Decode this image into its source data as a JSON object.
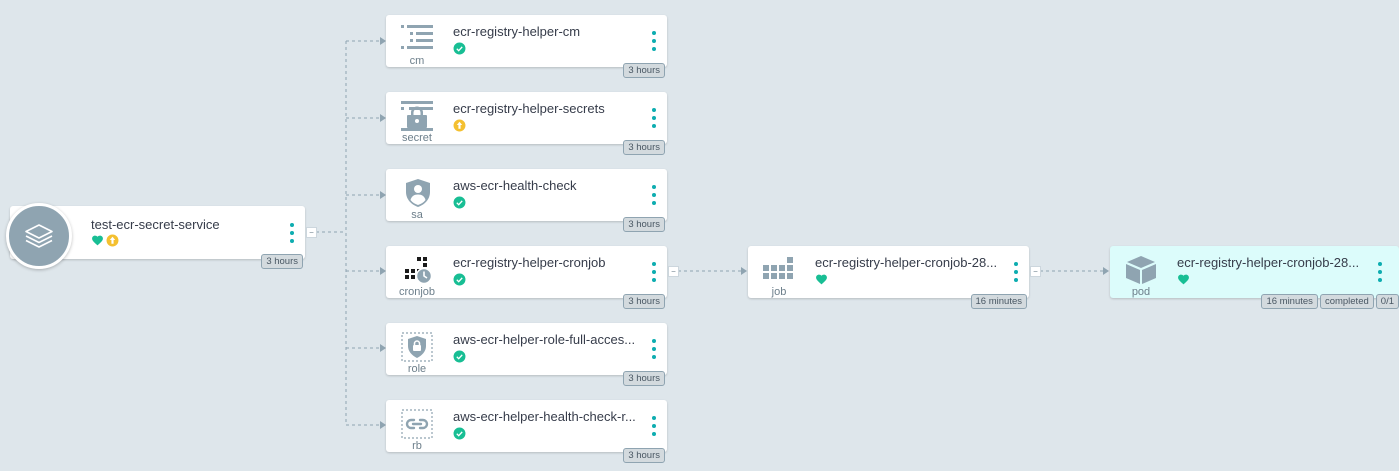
{
  "app": {
    "name": "test-ecr-secret-service",
    "age": "3 hours",
    "status_icons": [
      "healthy-heart-icon",
      "out-of-sync-icon"
    ]
  },
  "resources": [
    {
      "kind": "cm",
      "name": "ecr-registry-helper-cm",
      "status": "synced",
      "age": "3 hours",
      "icon": "configmap-icon"
    },
    {
      "kind": "secret",
      "name": "ecr-registry-helper-secrets",
      "status": "out-of-sync",
      "age": "3 hours",
      "icon": "secret-icon"
    },
    {
      "kind": "sa",
      "name": "aws-ecr-health-check",
      "status": "synced",
      "age": "3 hours",
      "icon": "service-account-icon"
    },
    {
      "kind": "cronjob",
      "name": "ecr-registry-helper-cronjob",
      "status": "synced",
      "age": "3 hours",
      "icon": "cronjob-icon"
    },
    {
      "kind": "role",
      "name": "aws-ecr-helper-role-full-acces...",
      "status": "synced",
      "age": "3 hours",
      "icon": "role-icon"
    },
    {
      "kind": "rb",
      "name": "aws-ecr-helper-health-check-r...",
      "status": "synced",
      "age": "3 hours",
      "icon": "rolebinding-icon"
    }
  ],
  "job": {
    "kind": "job",
    "name": "ecr-registry-helper-cronjob-28...",
    "age": "16 minutes",
    "status": "healthy"
  },
  "pod": {
    "kind": "pod",
    "name": "ecr-registry-helper-cronjob-28...",
    "age": "16 minutes",
    "phase": "completed",
    "ready": "0/1",
    "status": "healthy"
  },
  "colors": {
    "background": "#dee6eb",
    "healthy": "#18be94",
    "out_of_sync": "#f4c030",
    "menu": "#0dadb0",
    "icon_gray": "#8fa4b1",
    "pod_bg": "#dcfcfb"
  },
  "collapse_label": "−"
}
